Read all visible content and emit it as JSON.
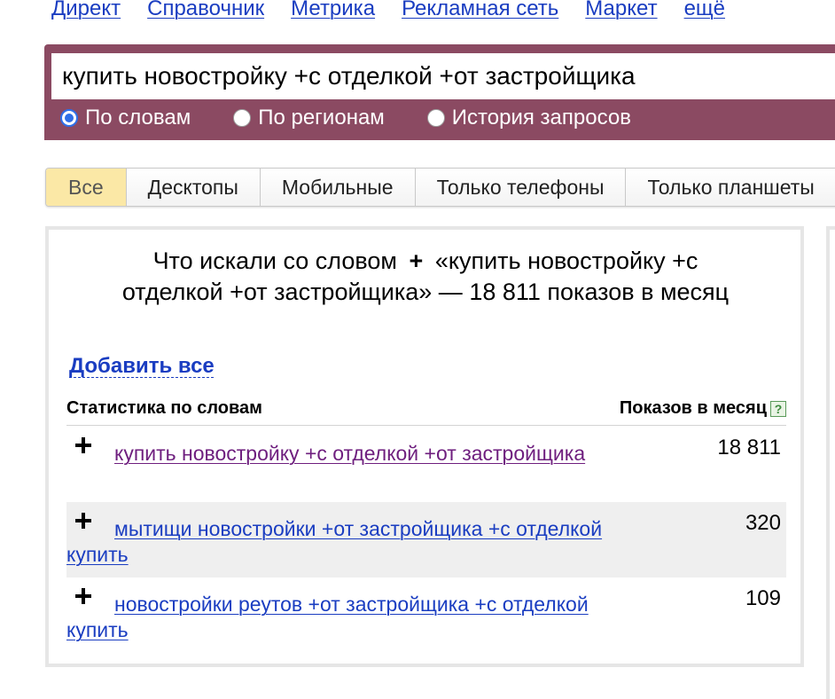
{
  "topnav": {
    "items": [
      "Директ",
      "Справочник",
      "Метрика",
      "Рекламная сеть",
      "Маркет",
      "ещё"
    ]
  },
  "search": {
    "value": "купить новостройку +с отделкой +от застройщика",
    "radios": [
      {
        "label": "По словам",
        "checked": true
      },
      {
        "label": "По регионам",
        "checked": false
      },
      {
        "label": "История запросов",
        "checked": false
      }
    ]
  },
  "tabs": [
    "Все",
    "Десктопы",
    "Мобильные",
    "Только телефоны",
    "Только планшеты"
  ],
  "results": {
    "title_prefix": "Что искали со словом",
    "title_plus": "+",
    "title_query": "«купить новостройку +с отделкой +от застройщика»",
    "title_sep": "—",
    "title_count": "18 811",
    "title_suffix": "показов в месяц",
    "add_all": "Добавить все",
    "col_left": "Статистика по словам",
    "col_right": "Показов в месяц",
    "help": "?",
    "rows": [
      {
        "phrase": "купить новостройку +с отделкой +от застройщика",
        "count": "18 811"
      },
      {
        "phrase": "мытищи новостройки +от застройщика +с отделкой купить",
        "count": "320"
      },
      {
        "phrase": "новостройки реутов +от застройщика +с отделкой купить",
        "count": "109"
      }
    ]
  },
  "colors": {
    "search_band": "#8b4a62",
    "link": "#1a3dc1",
    "visited_link": "#6e1e7e",
    "active_tab": "#fbe8a6",
    "radio_selected": "#2f6fe8"
  }
}
